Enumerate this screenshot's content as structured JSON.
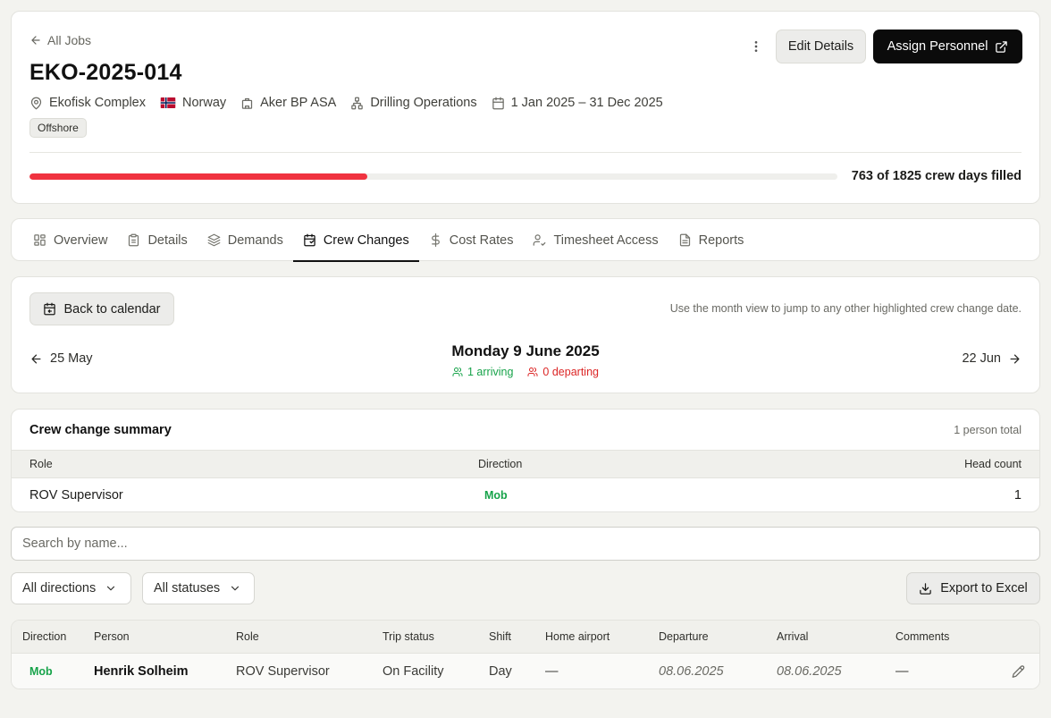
{
  "header": {
    "back_label": "All Jobs",
    "job_id": "EKO-2025-014",
    "location": "Ekofisk Complex",
    "country": "Norway",
    "client": "Aker BP ASA",
    "department": "Drilling Operations",
    "date_range": "1 Jan 2025 – 31 Dec 2025",
    "badge": "Offshore",
    "edit_label": "Edit Details",
    "assign_label": "Assign Personnel",
    "progress": {
      "filled": 763,
      "total": 1825,
      "text": "763 of 1825 crew days filled",
      "color": "#f03340"
    }
  },
  "tabs": [
    {
      "label": "Overview",
      "icon": "dashboard-icon"
    },
    {
      "label": "Details",
      "icon": "clipboard-icon"
    },
    {
      "label": "Demands",
      "icon": "layers-icon"
    },
    {
      "label": "Crew Changes",
      "icon": "calendar-icon",
      "active": true
    },
    {
      "label": "Cost Rates",
      "icon": "dollar-icon"
    },
    {
      "label": "Timesheet Access",
      "icon": "user-check-icon"
    },
    {
      "label": "Reports",
      "icon": "file-text-icon"
    }
  ],
  "crew_nav": {
    "back_calendar_label": "Back to calendar",
    "hint": "Use the month view to jump to any other highlighted crew change date.",
    "prev_label": "25 May",
    "next_label": "22 Jun",
    "date_title": "Monday 9 June 2025",
    "arriving": "1 arriving",
    "departing": "0 departing",
    "arriving_color": "#17a34a",
    "departing_color": "#dc2626"
  },
  "summary": {
    "title": "Crew change summary",
    "total": "1 person total",
    "columns": {
      "role": "Role",
      "direction": "Direction",
      "head_count": "Head count"
    },
    "rows": [
      {
        "role": "ROV Supervisor",
        "direction": "Mob",
        "head_count": "1"
      }
    ]
  },
  "search": {
    "placeholder": "Search by name...",
    "value": ""
  },
  "filters": {
    "direction": "All directions",
    "status": "All statuses",
    "export_label": "Export to Excel"
  },
  "people_table": {
    "columns": {
      "direction": "Direction",
      "person": "Person",
      "role": "Role",
      "trip_status": "Trip status",
      "shift": "Shift",
      "home_airport": "Home airport",
      "departure": "Departure",
      "arrival": "Arrival",
      "comments": "Comments"
    },
    "rows": [
      {
        "direction": "Mob",
        "person": "Henrik Solheim",
        "role": "ROV Supervisor",
        "trip_status": "On Facility",
        "shift": "Day",
        "home_airport": "—",
        "departure": "08.06.2025",
        "arrival": "08.06.2025",
        "comments": "—"
      }
    ]
  }
}
